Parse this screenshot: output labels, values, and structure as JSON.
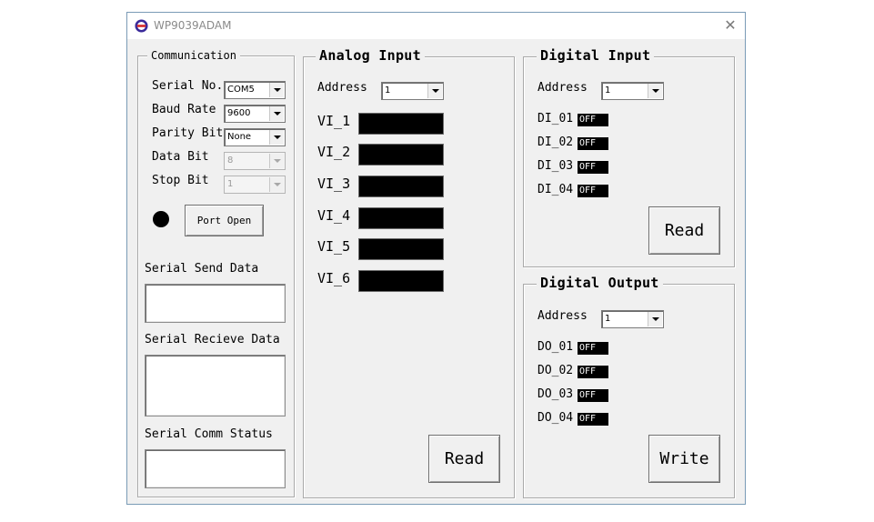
{
  "window": {
    "title": "WP9039ADAM",
    "close_glyph": "✕",
    "brand_color": "#3a2a9a",
    "accent_color": "#d62a2a"
  },
  "communication": {
    "title": "Communication",
    "serial_no": {
      "label": "Serial No.",
      "value": "COM5"
    },
    "baud_rate": {
      "label": "Baud Rate",
      "value": "9600"
    },
    "parity_bit": {
      "label": "Parity Bit",
      "value": "None"
    },
    "data_bit": {
      "label": "Data Bit",
      "value": "8"
    },
    "stop_bit": {
      "label": "Stop Bit",
      "value": "1"
    },
    "port_open_label": "Port Open",
    "send_label": "Serial Send Data",
    "receive_label": "Serial Recieve Data",
    "status_label": "Serial Comm Status"
  },
  "analog_input": {
    "title": "Analog Input",
    "address_label": "Address",
    "address_value": "1",
    "channels": [
      "VI_1",
      "VI_2",
      "VI_3",
      "VI_4",
      "VI_5",
      "VI_6"
    ],
    "read_label": "Read"
  },
  "digital_input": {
    "title": "Digital Input",
    "address_label": "Address",
    "address_value": "1",
    "channels": [
      {
        "label": "DI_01",
        "state": "OFF"
      },
      {
        "label": "DI_02",
        "state": "OFF"
      },
      {
        "label": "DI_03",
        "state": "OFF"
      },
      {
        "label": "DI_04",
        "state": "OFF"
      }
    ],
    "read_label": "Read"
  },
  "digital_output": {
    "title": "Digital Output",
    "address_label": "Address",
    "address_value": "1",
    "channels": [
      {
        "label": "DO_01",
        "state": "OFF"
      },
      {
        "label": "DO_02",
        "state": "OFF"
      },
      {
        "label": "DO_03",
        "state": "OFF"
      },
      {
        "label": "DO_04",
        "state": "OFF"
      }
    ],
    "write_label": "Write"
  }
}
